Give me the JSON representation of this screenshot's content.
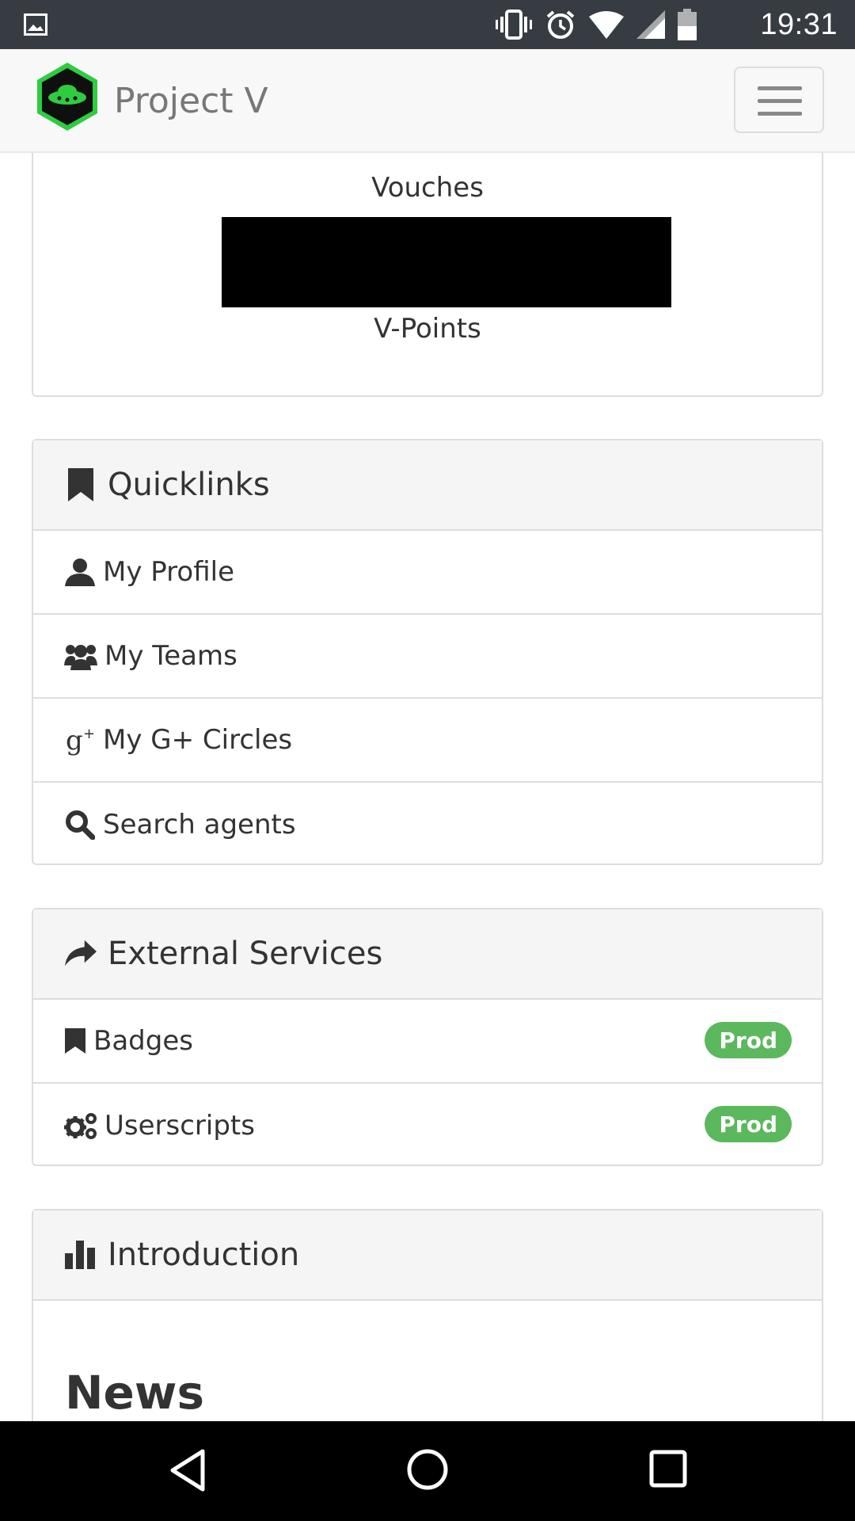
{
  "status_bar": {
    "time": "19:31",
    "icons": [
      "image-icon",
      "vibrate-icon",
      "alarm-icon",
      "wifi-icon",
      "signal-icon",
      "battery-icon"
    ]
  },
  "navbar": {
    "brand": "Project V",
    "menu_icon": "hamburger-icon"
  },
  "stats": {
    "vouches_label": "Vouches",
    "vpoints_label": "V-Points"
  },
  "quicklinks": {
    "title": "Quicklinks",
    "items": [
      {
        "label": "My Profile",
        "icon": "user-icon"
      },
      {
        "label": "My Teams",
        "icon": "users-icon"
      },
      {
        "label": "My G+ Circles",
        "icon": "google-plus-icon"
      },
      {
        "label": "Search agents",
        "icon": "search-icon"
      }
    ]
  },
  "external_services": {
    "title": "External Services",
    "items": [
      {
        "label": "Badges",
        "icon": "bookmark-icon",
        "badge": "Prod"
      },
      {
        "label": "Userscripts",
        "icon": "gears-icon",
        "badge": "Prod"
      }
    ]
  },
  "introduction": {
    "title": "Introduction",
    "news_heading": "News"
  },
  "colors": {
    "status_bar": "#373c42",
    "badge_green": "#5cb85c",
    "panel_heading_bg": "#f5f5f5",
    "border": "#dddddd",
    "logo_green": "#2ecc40"
  },
  "system_nav": [
    "back-icon",
    "home-icon",
    "recents-icon"
  ]
}
